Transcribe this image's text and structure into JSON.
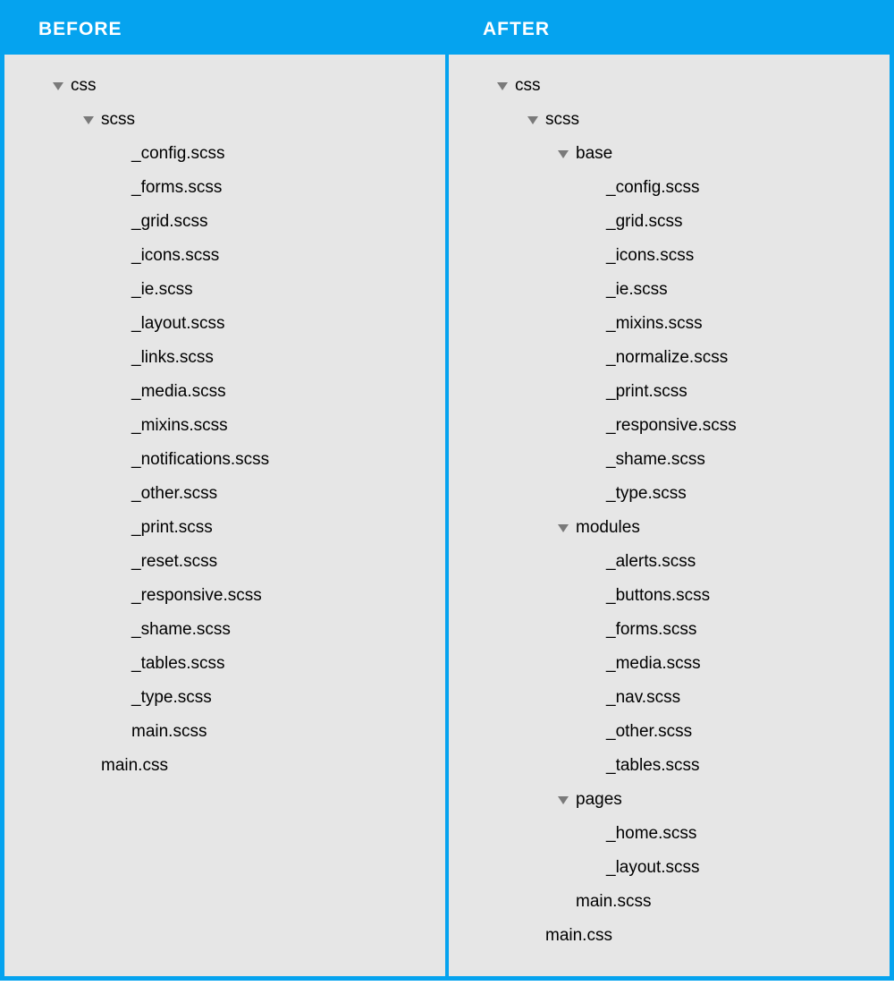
{
  "columns": {
    "before": {
      "title": "BEFORE",
      "tree": [
        {
          "depth": 1,
          "folder": true,
          "label": "css"
        },
        {
          "depth": 2,
          "folder": true,
          "label": "scss"
        },
        {
          "depth": 3,
          "folder": false,
          "label": "_config.scss"
        },
        {
          "depth": 3,
          "folder": false,
          "label": "_forms.scss"
        },
        {
          "depth": 3,
          "folder": false,
          "label": "_grid.scss"
        },
        {
          "depth": 3,
          "folder": false,
          "label": "_icons.scss"
        },
        {
          "depth": 3,
          "folder": false,
          "label": "_ie.scss"
        },
        {
          "depth": 3,
          "folder": false,
          "label": "_layout.scss"
        },
        {
          "depth": 3,
          "folder": false,
          "label": "_links.scss"
        },
        {
          "depth": 3,
          "folder": false,
          "label": "_media.scss"
        },
        {
          "depth": 3,
          "folder": false,
          "label": "_mixins.scss"
        },
        {
          "depth": 3,
          "folder": false,
          "label": "_notifications.scss"
        },
        {
          "depth": 3,
          "folder": false,
          "label": "_other.scss"
        },
        {
          "depth": 3,
          "folder": false,
          "label": "_print.scss"
        },
        {
          "depth": 3,
          "folder": false,
          "label": "_reset.scss"
        },
        {
          "depth": 3,
          "folder": false,
          "label": "_responsive.scss"
        },
        {
          "depth": 3,
          "folder": false,
          "label": "_shame.scss"
        },
        {
          "depth": 3,
          "folder": false,
          "label": "_tables.scss"
        },
        {
          "depth": 3,
          "folder": false,
          "label": "_type.scss"
        },
        {
          "depth": 3,
          "folder": false,
          "label": "main.scss"
        },
        {
          "depth": 2,
          "folder": false,
          "label": "main.css"
        }
      ]
    },
    "after": {
      "title": "AFTER",
      "tree": [
        {
          "depth": 1,
          "folder": true,
          "label": "css"
        },
        {
          "depth": 2,
          "folder": true,
          "label": "scss"
        },
        {
          "depth": 3,
          "folder": true,
          "label": "base"
        },
        {
          "depth": 4,
          "folder": false,
          "label": "_config.scss"
        },
        {
          "depth": 4,
          "folder": false,
          "label": "_grid.scss"
        },
        {
          "depth": 4,
          "folder": false,
          "label": "_icons.scss"
        },
        {
          "depth": 4,
          "folder": false,
          "label": "_ie.scss"
        },
        {
          "depth": 4,
          "folder": false,
          "label": "_mixins.scss"
        },
        {
          "depth": 4,
          "folder": false,
          "label": "_normalize.scss"
        },
        {
          "depth": 4,
          "folder": false,
          "label": "_print.scss"
        },
        {
          "depth": 4,
          "folder": false,
          "label": "_responsive.scss"
        },
        {
          "depth": 4,
          "folder": false,
          "label": "_shame.scss"
        },
        {
          "depth": 4,
          "folder": false,
          "label": "_type.scss"
        },
        {
          "depth": 3,
          "folder": true,
          "label": "modules"
        },
        {
          "depth": 4,
          "folder": false,
          "label": "_alerts.scss"
        },
        {
          "depth": 4,
          "folder": false,
          "label": "_buttons.scss"
        },
        {
          "depth": 4,
          "folder": false,
          "label": "_forms.scss"
        },
        {
          "depth": 4,
          "folder": false,
          "label": "_media.scss"
        },
        {
          "depth": 4,
          "folder": false,
          "label": "_nav.scss"
        },
        {
          "depth": 4,
          "folder": false,
          "label": "_other.scss"
        },
        {
          "depth": 4,
          "folder": false,
          "label": "_tables.scss"
        },
        {
          "depth": 3,
          "folder": true,
          "label": "pages"
        },
        {
          "depth": 4,
          "folder": false,
          "label": "_home.scss"
        },
        {
          "depth": 4,
          "folder": false,
          "label": "_layout.scss"
        },
        {
          "depth": 3,
          "folder": false,
          "label": "main.scss"
        },
        {
          "depth": 2,
          "folder": false,
          "label": "main.css"
        }
      ]
    }
  }
}
